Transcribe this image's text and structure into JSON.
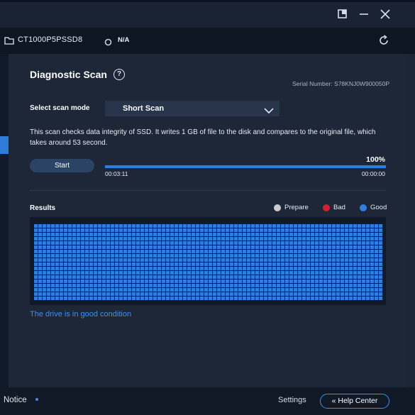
{
  "drive": {
    "name": "CT1000P5PSSD8",
    "temperature": "N/A"
  },
  "diagnostic": {
    "title": "Diagnostic Scan",
    "help_icon": "?",
    "serial": "Serial Number: S78KNJ0W900050P",
    "mode_label": "Select scan mode",
    "mode_value": "Short Scan",
    "description": "This scan checks data integrity of SSD. It writes 1 GB of file to the disk and compares to the original file, which takes around 53 second.",
    "start_label": "Start",
    "progress_percent": 100,
    "progress_text": "100%",
    "elapsed": "00:03:11",
    "remaining": "00:00:00"
  },
  "results": {
    "label": "Results",
    "legend": [
      {
        "label": "Prepare",
        "color": "#c6c9cf"
      },
      {
        "label": "Bad",
        "color": "#d61f33"
      },
      {
        "label": "Good",
        "color": "#2f7fe1"
      }
    ],
    "block_state": "Good",
    "block_color": "#2f7fe1",
    "status": "The drive is in good condition"
  },
  "footer": {
    "notice": "Notice",
    "settings": "Settings",
    "help_center": "Help Center",
    "help_center_icon": "«"
  },
  "icons": {
    "window": [
      "restore-icon",
      "minimize-icon",
      "close-icon"
    ],
    "drive": "drive-icon",
    "temperature": "temperature-ring-icon",
    "refresh": "refresh-icon",
    "chevron": "chevron-down-icon"
  }
}
